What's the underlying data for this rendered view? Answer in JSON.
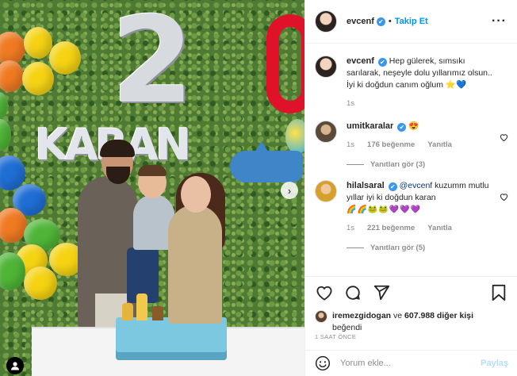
{
  "photo": {
    "balloon_letters": [
      "K",
      "A",
      "R",
      "A",
      "N"
    ],
    "big_digit": "2",
    "next_arrow": "›",
    "user_tag_icon": "user-icon"
  },
  "header": {
    "username": "evcenf",
    "verified": "✔",
    "separator": "•",
    "follow_label": "Takip Et",
    "more_label": "···"
  },
  "caption": {
    "username": "evcenf",
    "text": "Hep gülerek, sımsıkı sarılarak, neşeyle dolu yıllarımız olsun.. İyi ki doğdun canım oğlum ⭐💙",
    "time": "1s"
  },
  "comments": [
    {
      "username": "umitkaralar",
      "text": "😍",
      "time": "1s",
      "likes": "176 beğenme",
      "reply_label": "Yanıtla",
      "view_replies": "Yanıtları gör (3)"
    },
    {
      "username": "hilalsaral",
      "mention": "@evcenf",
      "text": " kuzumm mutlu yıllar iyi ki doğdun karan",
      "emojis": "🌈🌈🐸🐸💜💜💜",
      "time": "1s",
      "likes": "221 beğenme",
      "reply_label": "Yanıtla",
      "view_replies": "Yanıtları gör (5)"
    }
  ],
  "actions": {
    "liked_by_user": "iremezgidogan",
    "liked_by_joiner": " ve ",
    "liked_by_count": "607.988 diğer kişi",
    "liked_by_suffix": "beğendi",
    "timestamp": "1 SAAT ÖNCE"
  },
  "add_comment": {
    "placeholder": "Yorum ekle...",
    "post_label": "Paylaş"
  },
  "colors": {
    "accent": "#0095f6",
    "verified": "#3897f0",
    "muted_text": "#8e8e8e"
  }
}
